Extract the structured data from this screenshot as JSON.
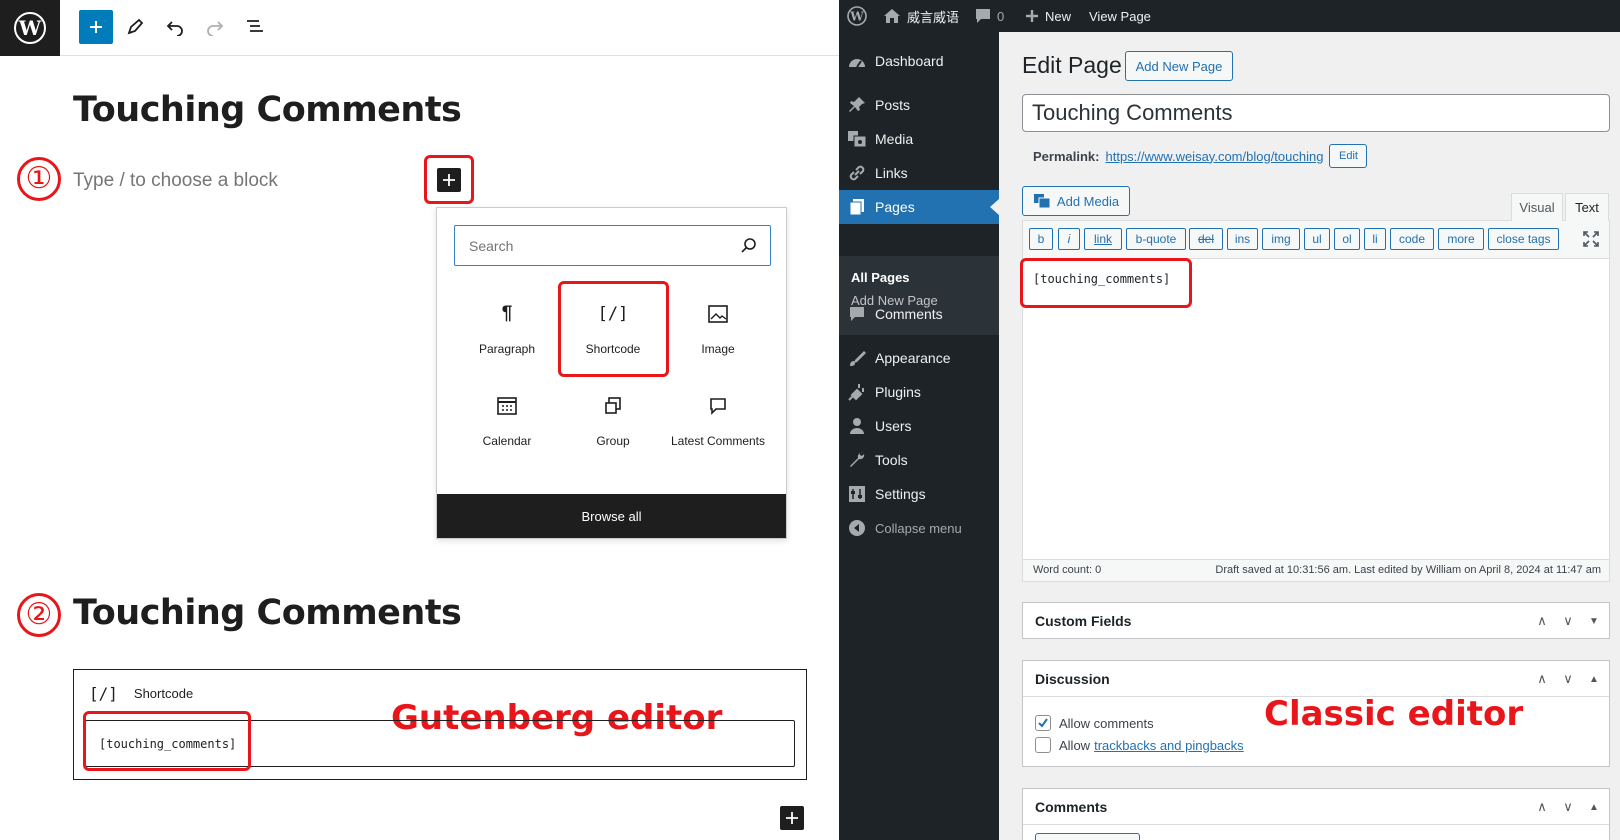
{
  "gutenberg": {
    "page_title": "Touching Comments",
    "step1": "①",
    "step2": "②",
    "block_placeholder": "Type / to choose a block",
    "search_placeholder": "Search",
    "blocks": [
      {
        "label": "Paragraph",
        "icon": "paragraph-icon"
      },
      {
        "label": "Shortcode",
        "icon": "shortcode-icon",
        "glyph": "[/]"
      },
      {
        "label": "Image",
        "icon": "image-icon"
      },
      {
        "label": "Calendar",
        "icon": "calendar-icon"
      },
      {
        "label": "Group",
        "icon": "group-icon"
      },
      {
        "label": "Latest Comments",
        "icon": "comment-icon"
      }
    ],
    "browse_all": "Browse all",
    "shortcode_block_label": "Shortcode",
    "shortcode_glyph": "[/]",
    "shortcode_value": "[touching_comments]",
    "annotation": "Gutenberg editor"
  },
  "classic": {
    "adminbar": {
      "site_name": "威言威语",
      "comments_count": "0",
      "new_label": "New",
      "view_page": "View Page"
    },
    "menu": {
      "dashboard": "Dashboard",
      "posts": "Posts",
      "media": "Media",
      "links": "Links",
      "pages": "Pages",
      "all_pages": "All Pages",
      "add_new_page": "Add New Page",
      "comments": "Comments",
      "appearance": "Appearance",
      "plugins": "Plugins",
      "users": "Users",
      "tools": "Tools",
      "settings": "Settings",
      "collapse": "Collapse menu"
    },
    "heading": "Edit Page",
    "add_new_button": "Add New Page",
    "title_value": "Touching Comments",
    "permalink_label": "Permalink:",
    "permalink_url": "https://www.weisay.com/blog/touching",
    "permalink_edit": "Edit",
    "add_media": "Add Media",
    "tab_visual": "Visual",
    "tab_text": "Text",
    "quicktags": [
      "b",
      "i",
      "link",
      "b-quote",
      "del",
      "ins",
      "img",
      "ul",
      "ol",
      "li",
      "code",
      "more",
      "close tags"
    ],
    "content": "[touching_comments]",
    "word_count": "Word count: 0",
    "draft_status": "Draft saved at 10:31:56 am. Last edited by William on April 8, 2024 at 11:47 am",
    "panels": {
      "custom_fields": "Custom Fields",
      "discussion": "Discussion",
      "allow_comments": "Allow comments",
      "allow_prefix": "Allow",
      "trackbacks_link": "trackbacks and pingbacks",
      "comments": "Comments"
    },
    "annotation": "Classic editor"
  },
  "colors": {
    "annotation_red": "#e8161a",
    "wp_blue": "#2271b1",
    "gutenberg_blue": "#007cba",
    "admin_dark": "#1d2327"
  }
}
